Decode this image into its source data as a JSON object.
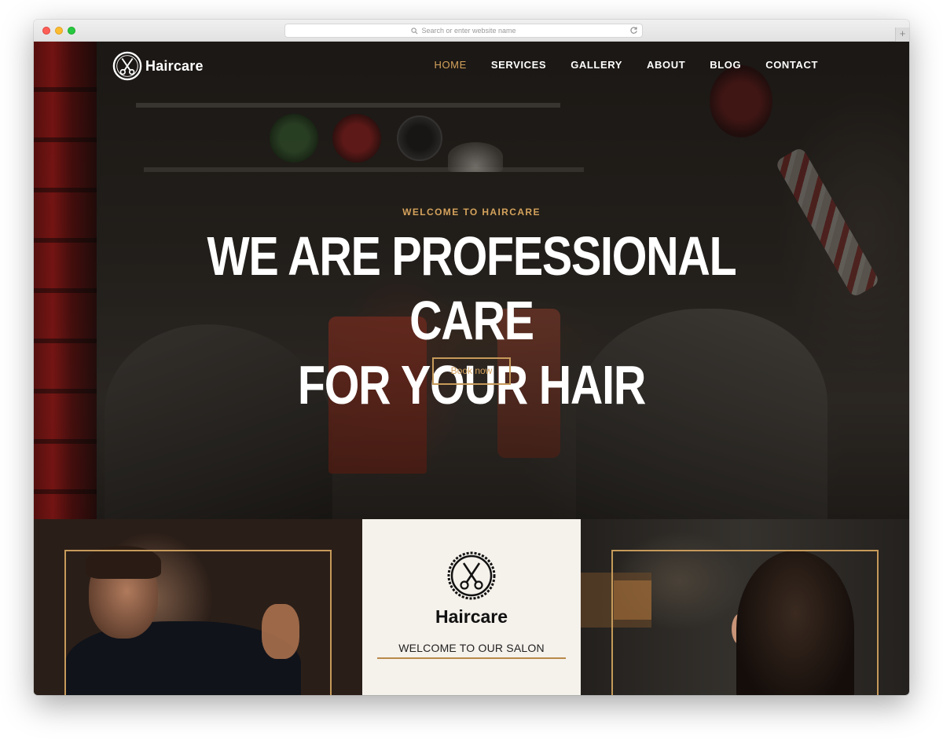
{
  "browser": {
    "address_placeholder": "Search or enter website name",
    "new_tab": "+"
  },
  "header": {
    "brand": "Haircare",
    "nav": [
      {
        "label": "HOME",
        "active": true
      },
      {
        "label": "SERVICES",
        "active": false
      },
      {
        "label": "GALLERY",
        "active": false
      },
      {
        "label": "ABOUT",
        "active": false
      },
      {
        "label": "BLOG",
        "active": false
      },
      {
        "label": "CONTACT",
        "active": false
      }
    ]
  },
  "hero": {
    "subtitle": "WELCOME TO HAIRCARE",
    "title_line1": "WE ARE PROFESSIONAL CARE",
    "title_line2": "FOR YOUR HAIR",
    "cta": "Book now"
  },
  "about": {
    "brand": "Haircare",
    "welcome": "WELCOME TO OUR SALON"
  },
  "colors": {
    "accent": "#d4a25c",
    "frame": "#c69a5a",
    "panel_bg": "#f5f1eb"
  },
  "icons": {
    "logo": "scissors-badge-icon",
    "search": "search-icon",
    "reload": "reload-icon"
  }
}
